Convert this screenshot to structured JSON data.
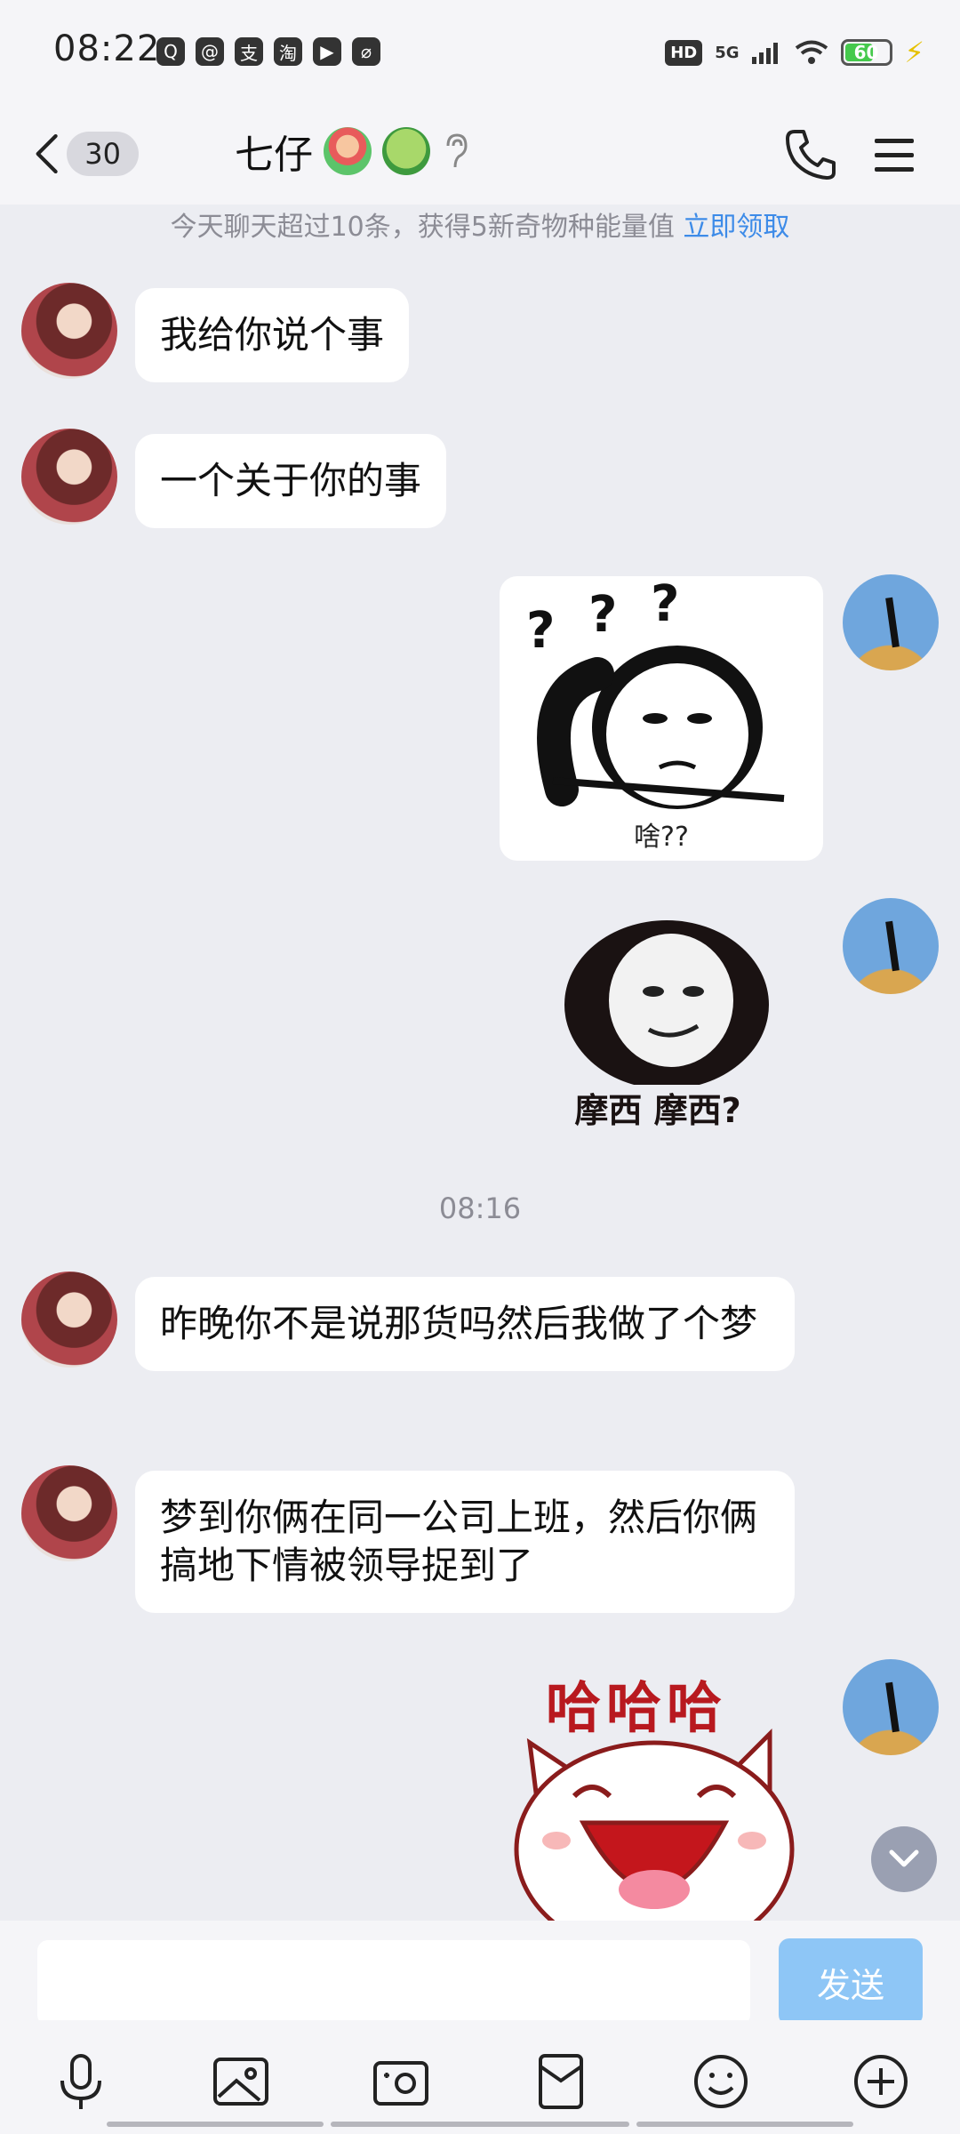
{
  "status_bar": {
    "time": "08:22",
    "notification_icons": [
      "Q",
      "@",
      "支",
      "淘",
      "▶",
      "⌀"
    ],
    "hd": "HD",
    "network": "5G",
    "battery": "60"
  },
  "header": {
    "unread_count": "30",
    "contact_name": "七仔"
  },
  "notice": {
    "text": "今天聊天超过10条，获得5新奇物种能量值 ",
    "link": "立即领取"
  },
  "messages": [
    {
      "text": "我给你说个事"
    },
    {
      "text": "一个关于你的事"
    },
    {
      "sticker_caption": "啥??"
    },
    {
      "sticker_caption": "摩西 摩西?"
    },
    {
      "text": "昨晚你不是说那货吗然后我做了个梦"
    },
    {
      "text": "梦到你俩在同一公司上班，然后你俩搞地下情被领导捉到了"
    },
    {
      "sticker_caption": "哈哈哈"
    }
  ],
  "timestamp": "08:16",
  "input": {
    "send_label": "发送"
  }
}
